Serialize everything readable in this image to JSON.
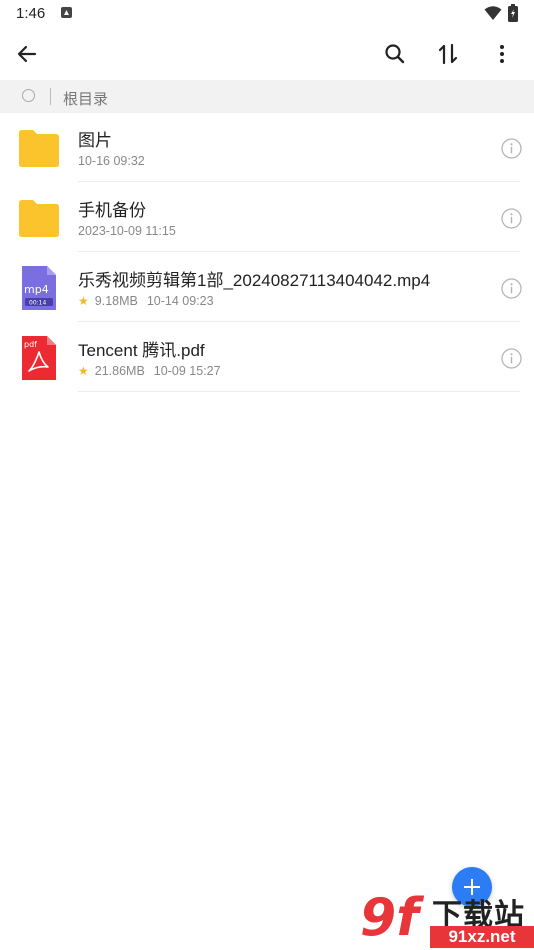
{
  "status_bar": {
    "time": "1:46"
  },
  "breadcrumb": {
    "label": "根目录"
  },
  "files": [
    {
      "name": "图片",
      "type": "folder",
      "meta_date": "10-16 09:32"
    },
    {
      "name": "手机备份",
      "type": "folder",
      "meta_date": "2023-10-09 11:15"
    },
    {
      "name": "乐秀视频剪辑第1部_20240827113404042.mp4",
      "type": "mp4",
      "starred": true,
      "size": "9.18MB",
      "meta_date": "10-14 09:23",
      "thumb_ext": "mp4",
      "thumb_duration": "00:14"
    },
    {
      "name": "Tencent 腾讯.pdf",
      "type": "pdf",
      "starred": true,
      "size": "21.86MB",
      "meta_date": "10-09 15:27",
      "thumb_ext": "pdf"
    }
  ],
  "watermark": {
    "brand": "下载站",
    "url": "91xz.net"
  },
  "colors": {
    "folder": "#fcc42c",
    "mp4": "#7a6ee0",
    "pdf": "#ec2a32",
    "accent": "#2b7cf5",
    "star": "#f5b72a"
  }
}
